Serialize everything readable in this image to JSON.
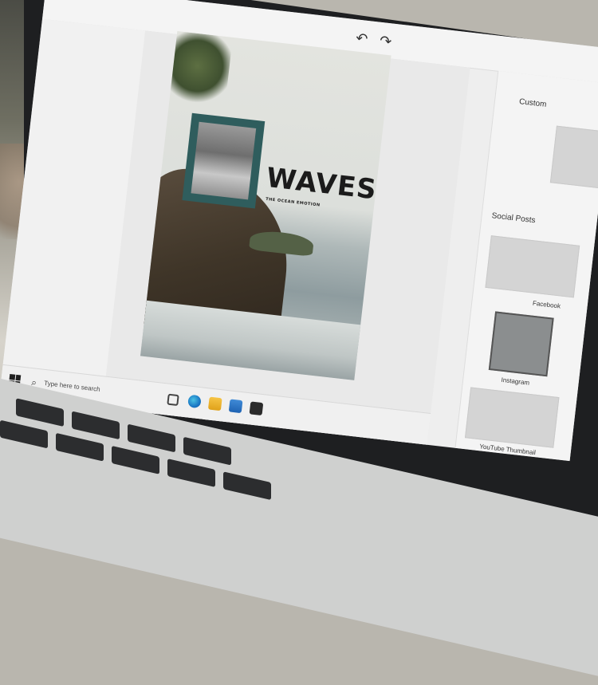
{
  "toolbar": {
    "undo_icon": "undo-icon",
    "redo_icon": "redo-icon"
  },
  "poster": {
    "title": "WAVES",
    "subtitle": "THE OCEAN EMOTION"
  },
  "templates": {
    "custom_label": "Custom",
    "social_label": "Social Posts",
    "items": [
      {
        "label": "Facebook"
      },
      {
        "label": "Instagram"
      },
      {
        "label": "YouTube Thumbnail"
      }
    ]
  },
  "taskbar": {
    "search_placeholder": "Type here to search",
    "icons": [
      "windows-start-icon",
      "search-icon",
      "task-view-icon",
      "edge-icon",
      "file-explorer-icon",
      "mail-icon",
      "store-icon"
    ]
  },
  "colors": {
    "frame_teal": "#2f5d5d",
    "canvas_bg": "#e9e9e9",
    "panel_bg": "#f4f4f4"
  }
}
